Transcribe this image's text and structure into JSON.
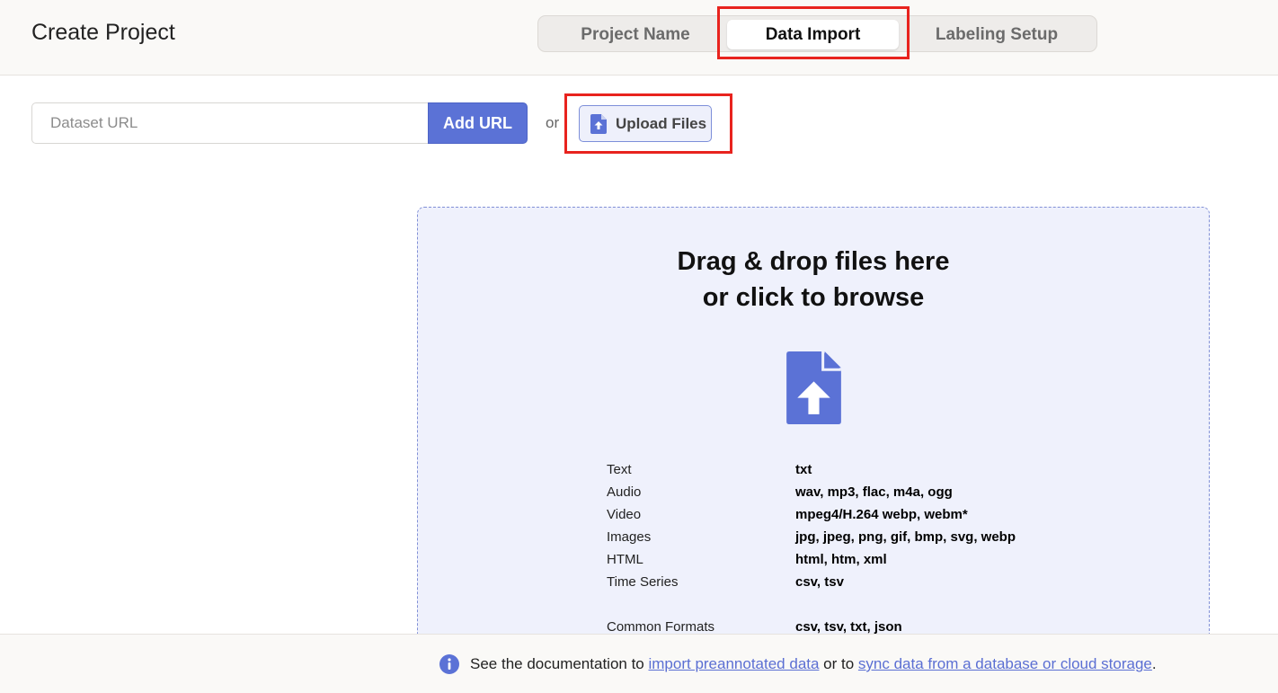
{
  "header": {
    "title": "Create Project",
    "steps": [
      {
        "label": "Project Name",
        "active": false
      },
      {
        "label": "Data Import",
        "active": true
      },
      {
        "label": "Labeling Setup",
        "active": false
      }
    ]
  },
  "url_row": {
    "placeholder": "Dataset URL",
    "value": "",
    "add_url_label": "Add URL",
    "or_text": "or",
    "upload_label": "Upload Files"
  },
  "dropzone": {
    "title_line1": "Drag & drop files here",
    "title_line2": "or click to browse",
    "formats": [
      {
        "type": "Text",
        "ext": "txt"
      },
      {
        "type": "Audio",
        "ext": "wav, mp3, flac, m4a, ogg"
      },
      {
        "type": "Video",
        "ext": "mpeg4/H.264 webp, webm*"
      },
      {
        "type": "Images",
        "ext": "jpg, jpeg, png, gif, bmp, svg, webp"
      },
      {
        "type": "HTML",
        "ext": "html, htm, xml"
      },
      {
        "type": "Time Series",
        "ext": "csv, tsv"
      },
      {
        "type": "Common Formats",
        "ext": "csv, tsv, txt, json"
      }
    ]
  },
  "footer": {
    "text_before": "See the documentation to ",
    "link1": "import preannotated data",
    "text_middle": " or to ",
    "link2": "sync data from a database or cloud storage",
    "text_after": "."
  },
  "colors": {
    "accent": "#5b72d6",
    "highlight": "#e8231e",
    "dropzone_bg": "#eff1fc"
  },
  "icons": [
    "file-upload-icon",
    "info-icon"
  ]
}
